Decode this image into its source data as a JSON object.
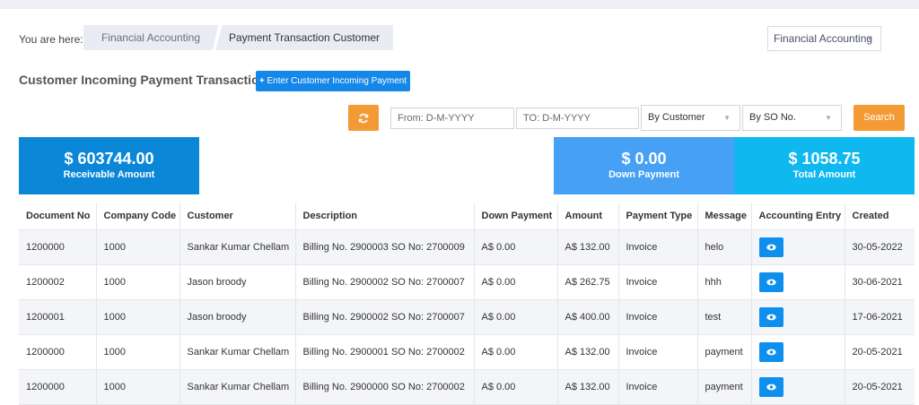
{
  "breadcrumb": {
    "label": "You are here:",
    "items": [
      "Financial Accounting",
      "Payment Transaction Customer"
    ]
  },
  "module_select": {
    "value": "Financial Accounting"
  },
  "page": {
    "title": "Customer Incoming Payment Transaction",
    "enter_button": "Enter Customer Incoming Payment"
  },
  "filters": {
    "from_placeholder": "From: D-M-YYYY",
    "to_placeholder": "TO: D-M-YYYY",
    "customer_select": "By Customer",
    "so_select": "By SO No.",
    "search_label": "Search",
    "refresh_icon": "refresh-icon"
  },
  "cards": {
    "receivable": {
      "amount": "$ 603744.00",
      "label": "Receivable Amount"
    },
    "down_payment": {
      "amount": "$ 0.00",
      "label": "Down Payment"
    },
    "total": {
      "amount": "$ 1058.75",
      "label": "Total Amount"
    }
  },
  "colors": {
    "primary": "#1587e8",
    "orange": "#f39a34",
    "card_receivable": "#0c87d8",
    "card_down": "#46a1f5",
    "card_total": "#0fb9ef"
  },
  "table": {
    "headers": [
      "Document No",
      "Company Code",
      "Customer",
      "Description",
      "Down Payment",
      "Amount",
      "Payment Type",
      "Message",
      "Accounting Entry",
      "Created"
    ],
    "rows": [
      [
        "1200000",
        "1000",
        "Sankar Kumar Chellam",
        "Billing No. 2900003 SO No: 2700009",
        "A$ 0.00",
        "A$ 132.00",
        "Invoice",
        "helo",
        "",
        "30-05-2022"
      ],
      [
        "1200002",
        "1000",
        "Jason broody",
        "Billing No. 2900002 SO No: 2700007",
        "A$ 0.00",
        "A$ 262.75",
        "Invoice",
        "hhh",
        "",
        "30-06-2021"
      ],
      [
        "1200001",
        "1000",
        "Jason broody",
        "Billing No. 2900002 SO No: 2700007",
        "A$ 0.00",
        "A$ 400.00",
        "Invoice",
        "test",
        "",
        "17-06-2021"
      ],
      [
        "1200000",
        "1000",
        "Sankar Kumar Chellam",
        "Billing No. 2900001 SO No: 2700002",
        "A$ 0.00",
        "A$ 132.00",
        "Invoice",
        "payment",
        "",
        "20-05-2021"
      ],
      [
        "1200000",
        "1000",
        "Sankar Kumar Chellam",
        "Billing No. 2900000 SO No: 2700002",
        "A$ 0.00",
        "A$ 132.00",
        "Invoice",
        "payment",
        "",
        "20-05-2021"
      ]
    ]
  }
}
